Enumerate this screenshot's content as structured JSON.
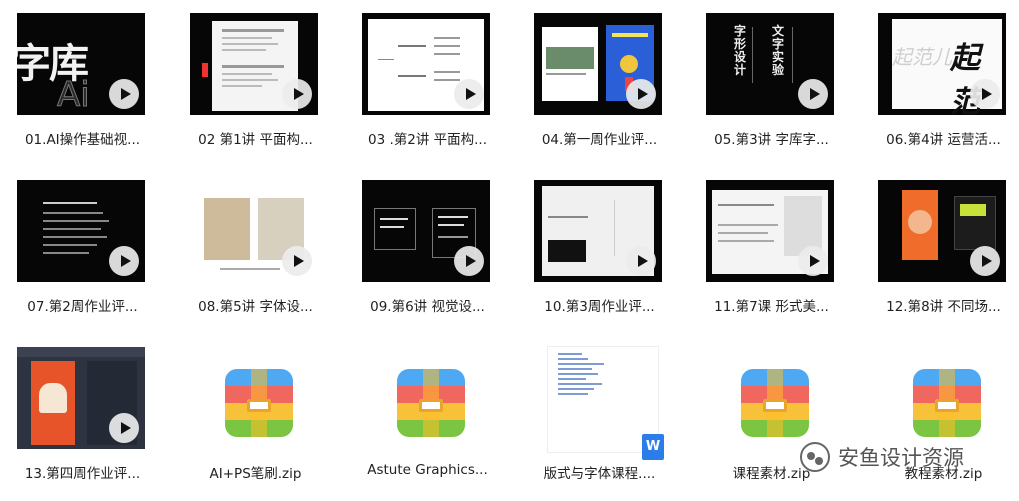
{
  "files": [
    {
      "name": "01.AI操作基础视...",
      "type": "video"
    },
    {
      "name": "02 第1讲 平面构...",
      "type": "video"
    },
    {
      "name": "03 .第2讲 平面构...",
      "type": "video"
    },
    {
      "name": "04.第一周作业评...",
      "type": "video"
    },
    {
      "name": "05.第3讲 字库字...",
      "type": "video"
    },
    {
      "name": "06.第4讲 运营活...",
      "type": "video"
    },
    {
      "name": "07.第2周作业评...",
      "type": "video"
    },
    {
      "name": "08.第5讲 字体设...",
      "type": "video"
    },
    {
      "name": "09.第6讲 视觉设...",
      "type": "video"
    },
    {
      "name": "10.第3周作业评...",
      "type": "video"
    },
    {
      "name": "11.第7课 形式美...",
      "type": "video"
    },
    {
      "name": "12.第8讲 不同场...",
      "type": "video"
    },
    {
      "name": "13.第四周作业评...",
      "type": "video"
    },
    {
      "name": "AI+PS笔刷.zip",
      "type": "zip"
    },
    {
      "name": "Astute Graphics...",
      "type": "zip"
    },
    {
      "name": "版式与字体课程....",
      "type": "doc"
    },
    {
      "name": "课程素材.zip",
      "type": "zip"
    },
    {
      "name": "教程素材.zip",
      "type": "zip"
    }
  ],
  "thumb_text": {
    "t1": "字库",
    "t1b": "Ai",
    "t5a": "字形设计",
    "t5b": "文字实验",
    "t6a": "起范儿",
    "t6b": "起范"
  },
  "watermark": {
    "text": "安鱼设计资源"
  },
  "colors": {
    "zip_blue": "#4ea8f2",
    "zip_red": "#f0675f",
    "zip_green": "#7cc542",
    "zip_yellow": "#f7c13a",
    "doc_badge": "#2b7de9",
    "video_bg": "#060606"
  },
  "icons": {
    "play": "play-icon",
    "zip": "zip-archive-icon",
    "doc": "word-document-icon",
    "watermark": "wechat-logo-icon"
  }
}
